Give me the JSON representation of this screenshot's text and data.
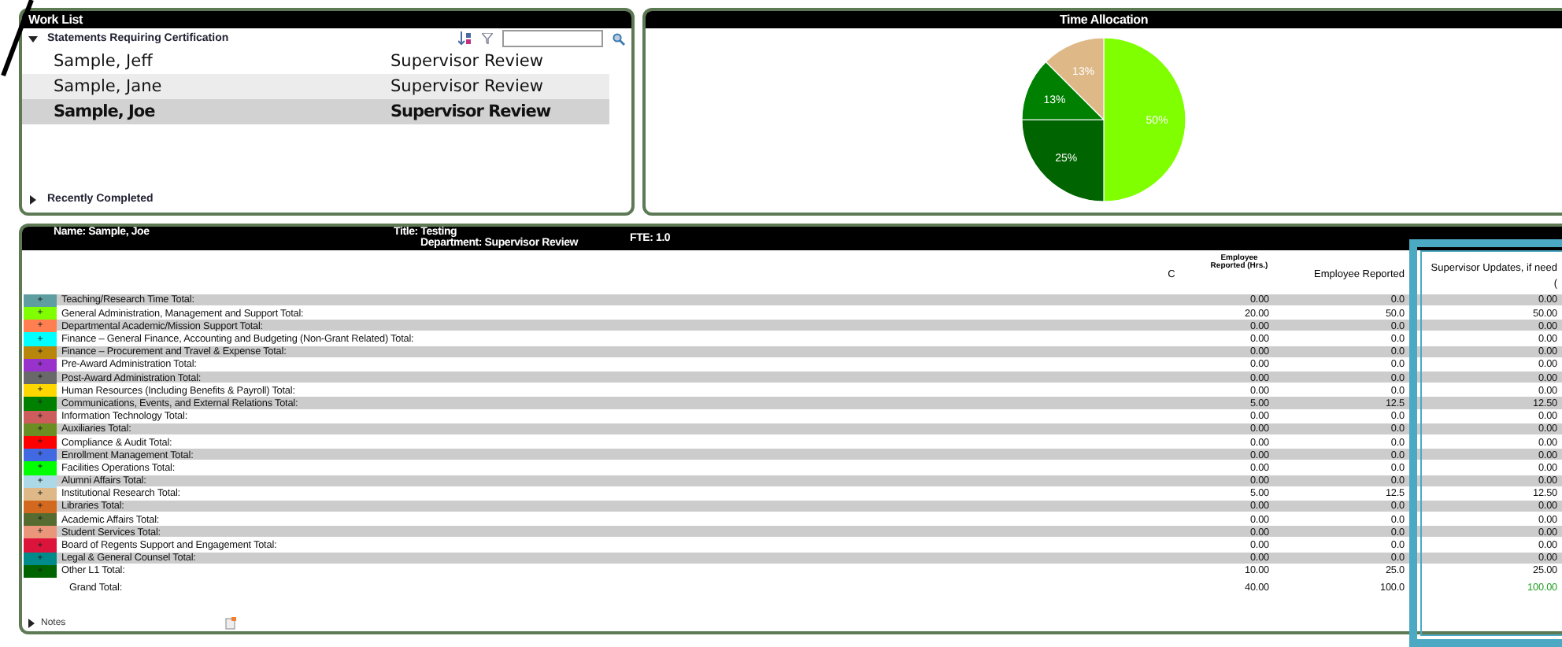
{
  "work_list": {
    "title": "Work List",
    "pending": {
      "label": "Statements Requiring Certification",
      "expanded": true
    },
    "rows": [
      {
        "name": "Sample, Jeff",
        "status": "Supervisor Review",
        "selected": false
      },
      {
        "name": "Sample, Jane",
        "status": "Supervisor Review",
        "selected": false
      },
      {
        "name": "Sample, Joe",
        "status": "Supervisor Review",
        "selected": true
      }
    ],
    "completed": {
      "label": "Recently Completed",
      "expanded": false
    }
  },
  "time_allocation": {
    "title": "Time Allocation",
    "chart_data": {
      "type": "pie",
      "values": [
        50,
        25,
        12.5,
        12.5
      ],
      "colors": [
        "#7fff00",
        "#006400",
        "#008000",
        "#deb887"
      ],
      "value_labels": [
        "50%",
        "25%",
        "13%",
        "13%"
      ]
    }
  },
  "statement": {
    "name": "Name: Sample, Joe",
    "title": "Title: Testing",
    "department": "Department: Supervisor Review",
    "fte": "FTE: 1.0",
    "columns": {
      "c": "C",
      "hours": "Employee Reported (Hrs.)",
      "employee": "Employee Reported",
      "supervisor": "Supervisor Updates, if need",
      "supervisor_sub": "("
    },
    "rows": [
      {
        "color": "#5f9ea0",
        "toggle": "+",
        "label": "Teaching/Research Time Total:",
        "hours": "0.00",
        "employee": "0.0",
        "supervisor": "0.00"
      },
      {
        "color": "#7fff00",
        "toggle": "+",
        "label": "General Administration, Management and Support Total:",
        "hours": "20.00",
        "employee": "50.0",
        "supervisor": "50.00"
      },
      {
        "color": "#ff7f50",
        "toggle": "+",
        "label": "Departmental Academic/Mission Support Total:",
        "hours": "0.00",
        "employee": "0.0",
        "supervisor": "0.00"
      },
      {
        "color": "#00ffff",
        "toggle": "+",
        "label": "Finance – General Finance, Accounting and Budgeting (Non-Grant Related) Total:",
        "hours": "0.00",
        "employee": "0.0",
        "supervisor": "0.00"
      },
      {
        "color": "#b8860b",
        "toggle": "+",
        "label": "Finance – Procurement and Travel & Expense Total:",
        "hours": "0.00",
        "employee": "0.0",
        "supervisor": "0.00"
      },
      {
        "color": "#9932cc",
        "toggle": "+",
        "label": "Pre-Award Administration Total:",
        "hours": "0.00",
        "employee": "0.0",
        "supervisor": "0.00"
      },
      {
        "color": "#696969",
        "toggle": "+",
        "label": "Post-Award Administration Total:",
        "hours": "0.00",
        "employee": "0.0",
        "supervisor": "0.00"
      },
      {
        "color": "#ffd700",
        "toggle": "+",
        "label": "Human Resources (Including Benefits & Payroll) Total:",
        "hours": "0.00",
        "employee": "0.0",
        "supervisor": "0.00"
      },
      {
        "color": "#008000",
        "toggle": "+",
        "label": "Communications, Events, and External Relations Total:",
        "hours": "5.00",
        "employee": "12.5",
        "supervisor": "12.50"
      },
      {
        "color": "#cd5c5c",
        "toggle": "+",
        "label": "Information Technology Total:",
        "hours": "0.00",
        "employee": "0.0",
        "supervisor": "0.00"
      },
      {
        "color": "#6b8e23",
        "toggle": "+",
        "label": "Auxiliaries Total:",
        "hours": "0.00",
        "employee": "0.0",
        "supervisor": "0.00"
      },
      {
        "color": "#ff0000",
        "toggle": "+",
        "label": "Compliance & Audit Total:",
        "hours": "0.00",
        "employee": "0.0",
        "supervisor": "0.00"
      },
      {
        "color": "#4169e1",
        "toggle": "+",
        "label": "Enrollment Management Total:",
        "hours": "0.00",
        "employee": "0.0",
        "supervisor": "0.00"
      },
      {
        "color": "#00ff00",
        "toggle": "+",
        "label": "Facilities Operations Total:",
        "hours": "0.00",
        "employee": "0.0",
        "supervisor": "0.00"
      },
      {
        "color": "#add8e6",
        "toggle": "+",
        "label": "Alumni Affairs Total:",
        "hours": "0.00",
        "employee": "0.0",
        "supervisor": "0.00"
      },
      {
        "color": "#deb887",
        "toggle": "+",
        "label": "Institutional Research Total:",
        "hours": "5.00",
        "employee": "12.5",
        "supervisor": "12.50"
      },
      {
        "color": "#d2691e",
        "toggle": "+",
        "label": "Libraries Total:",
        "hours": "0.00",
        "employee": "0.0",
        "supervisor": "0.00"
      },
      {
        "color": "#556b2f",
        "toggle": "+",
        "label": "Academic Affairs Total:",
        "hours": "0.00",
        "employee": "0.0",
        "supervisor": "0.00"
      },
      {
        "color": "#e9967a",
        "toggle": "+",
        "label": "Student Services Total:",
        "hours": "0.00",
        "employee": "0.0",
        "supervisor": "0.00"
      },
      {
        "color": "#dc143c",
        "toggle": "+",
        "label": "Board of Regents Support and Engagement Total:",
        "hours": "0.00",
        "employee": "0.0",
        "supervisor": "0.00"
      },
      {
        "color": "#008b8b",
        "toggle": "+",
        "label": "Legal & General Counsel Total:",
        "hours": "0.00",
        "employee": "0.0",
        "supervisor": "0.00"
      },
      {
        "color": "#006400",
        "toggle": "+",
        "label": "Other L1 Total:",
        "hours": "10.00",
        "employee": "25.0",
        "supervisor": "25.00"
      }
    ],
    "grand_total": {
      "label": "Grand Total:",
      "hours": "40.00",
      "employee": "100.0",
      "supervisor": "100.00"
    },
    "notes": {
      "label": "Notes",
      "expanded": false
    }
  }
}
